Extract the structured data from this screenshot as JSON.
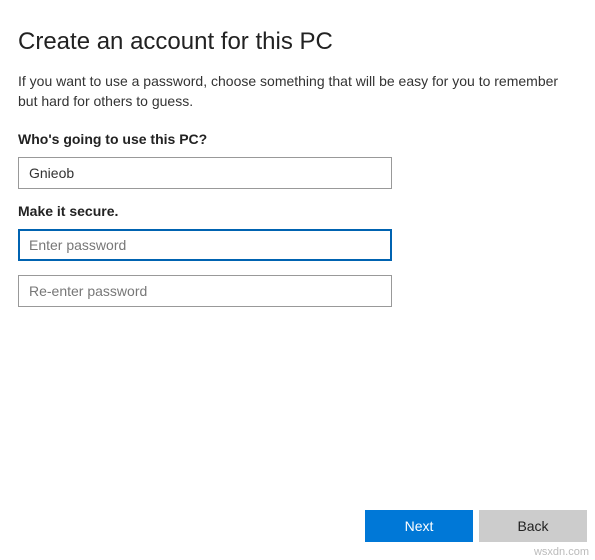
{
  "header": {
    "title": "Create an account for this PC",
    "description": "If you want to use a password, choose something that will be easy for you to remember but hard for others to guess."
  },
  "section_user": {
    "label": "Who's going to use this PC?",
    "username_value": "Gnieob"
  },
  "section_secure": {
    "label": "Make it secure.",
    "password_placeholder": "Enter password",
    "password_value": "",
    "confirm_placeholder": "Re-enter password",
    "confirm_value": ""
  },
  "footer": {
    "next_label": "Next",
    "back_label": "Back"
  },
  "watermark": "wsxdn.com"
}
